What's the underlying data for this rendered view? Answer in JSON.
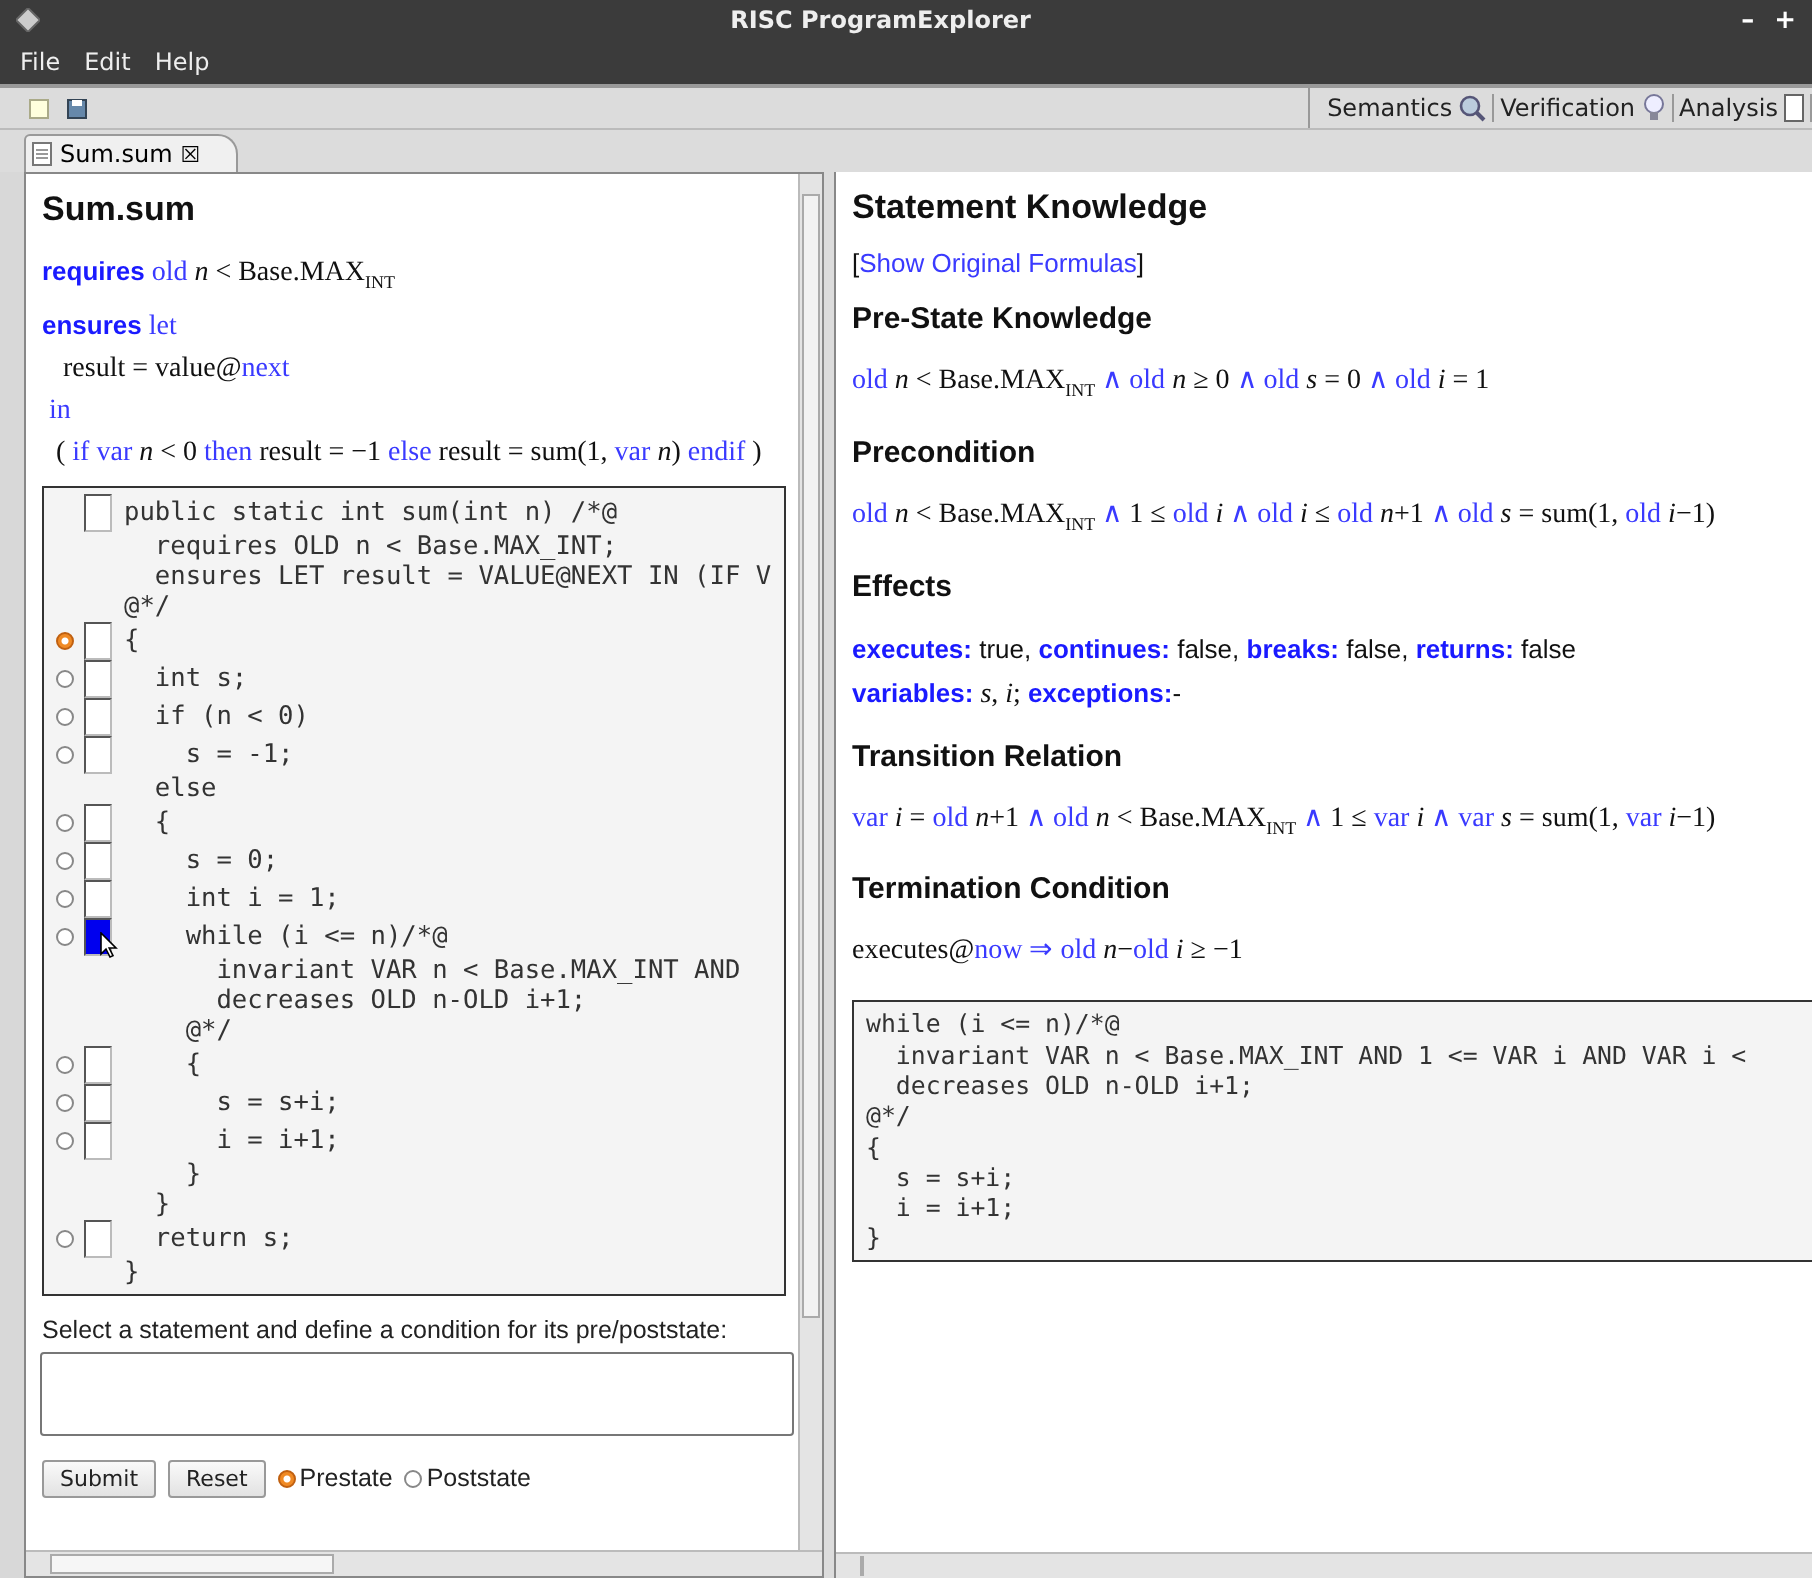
{
  "window": {
    "title": "RISC ProgramExplorer",
    "controls": [
      "–",
      "+"
    ]
  },
  "menu": [
    "File",
    "Edit",
    "Help"
  ],
  "perspectives": [
    {
      "label": "Semantics"
    },
    {
      "label": "Verification"
    },
    {
      "label": "Analysis"
    }
  ],
  "editor_tab": {
    "label": "Sum.sum",
    "close": "☒"
  },
  "method": {
    "title": "Sum.sum",
    "spec": [
      [
        {
          "kind": "label",
          "text": "requires"
        },
        {
          "kind": "kw",
          "text": " old"
        },
        {
          "kind": "math",
          "text": " *n* < Base.MAX$_{INT}$"
        }
      ],
      [
        {
          "kind": "label",
          "text": "ensures"
        },
        {
          "kind": "kw",
          "text": " let"
        }
      ],
      [
        {
          "kind": "math",
          "text": "   result = value@"
        },
        {
          "kind": "kw",
          "text": "next"
        }
      ],
      [
        {
          "kind": "kw",
          "text": " in"
        }
      ],
      [
        {
          "kind": "math",
          "text": "  ( "
        },
        {
          "kind": "kw",
          "text": "if var"
        },
        {
          "kind": "math",
          "text": " *n* < 0 "
        },
        {
          "kind": "kw",
          "text": "then"
        },
        {
          "kind": "math",
          "text": " result = −1 "
        },
        {
          "kind": "kw",
          "text": "else"
        },
        {
          "kind": "math",
          "text": " result = sum(1, "
        },
        {
          "kind": "kw",
          "text": "var"
        },
        {
          "kind": "math",
          "text": " *n*) "
        },
        {
          "kind": "kw",
          "text": "endif"
        },
        {
          "kind": "math",
          "text": " )"
        }
      ]
    ],
    "code": [
      {
        "kind": "header",
        "text": "public static int sum(int n) /*@",
        "highlighted": false
      },
      {
        "kind": "plain",
        "text": "  requires OLD n < Base.MAX_INT;"
      },
      {
        "kind": "plain",
        "text": "  ensures LET result = VALUE@NEXT IN (IF V"
      },
      {
        "kind": "plain",
        "text": "@*/"
      },
      {
        "kind": "statement",
        "text": "{",
        "selected": true,
        "highlighted": false
      },
      {
        "kind": "statement",
        "text": "  int s;",
        "selected": false,
        "highlighted": false
      },
      {
        "kind": "statement",
        "text": "  if (n < 0)",
        "selected": false,
        "highlighted": false
      },
      {
        "kind": "statement",
        "text": "    s = -1;",
        "selected": false,
        "highlighted": false
      },
      {
        "kind": "plain",
        "text": "  else"
      },
      {
        "kind": "statement",
        "text": "  {",
        "selected": false,
        "highlighted": false
      },
      {
        "kind": "statement",
        "text": "    s = 0;",
        "selected": false,
        "highlighted": false
      },
      {
        "kind": "statement",
        "text": "    int i = 1;",
        "selected": false,
        "highlighted": false
      },
      {
        "kind": "statement",
        "text": "    while (i <= n)/*@",
        "selected": false,
        "highlighted": true
      },
      {
        "kind": "plain",
        "text": "      invariant VAR n < Base.MAX_INT AND"
      },
      {
        "kind": "plain",
        "text": "      decreases OLD n-OLD i+1;"
      },
      {
        "kind": "plain",
        "text": "    @*/"
      },
      {
        "kind": "statement",
        "text": "    {",
        "selected": false,
        "highlighted": false
      },
      {
        "kind": "statement",
        "text": "      s = s+i;",
        "selected": false,
        "highlighted": false
      },
      {
        "kind": "statement",
        "text": "      i = i+1;",
        "selected": false,
        "highlighted": false
      },
      {
        "kind": "plain",
        "text": "    }"
      },
      {
        "kind": "plain",
        "text": "  }"
      },
      {
        "kind": "statement",
        "text": "  return s;",
        "selected": false,
        "highlighted": false
      },
      {
        "kind": "plain",
        "text": "}"
      }
    ]
  },
  "condition": {
    "label": "Select a statement and define a condition for its pre/poststate:",
    "buttons": [
      "Submit",
      "Reset"
    ],
    "states": [
      {
        "label": "Prestate",
        "selected": true
      },
      {
        "label": "Poststate",
        "selected": false
      }
    ]
  },
  "knowledge": {
    "title": "Statement Knowledge",
    "link": {
      "open": "[",
      "text": "Show Original Formulas",
      "close": "]"
    },
    "sections": [
      {
        "heading": "Pre-State Knowledge",
        "lines": [
          [
            {
              "kind": "kw",
              "text": "old"
            },
            {
              "kind": "math",
              "text": " *n* < Base.MAX$_{INT}$ "
            },
            {
              "kind": "kw",
              "text": "∧ old"
            },
            {
              "kind": "math",
              "text": " *n* ≥ 0 "
            },
            {
              "kind": "kw",
              "text": "∧ old"
            },
            {
              "kind": "math",
              "text": " *s* = 0 "
            },
            {
              "kind": "kw",
              "text": "∧ old"
            },
            {
              "kind": "math",
              "text": " *i* = 1"
            }
          ]
        ]
      },
      {
        "heading": "Precondition",
        "lines": [
          [
            {
              "kind": "kw",
              "text": "old"
            },
            {
              "kind": "math",
              "text": " *n* < Base.MAX$_{INT}$ "
            },
            {
              "kind": "kw",
              "text": "∧"
            },
            {
              "kind": "math",
              "text": " 1 ≤ "
            },
            {
              "kind": "kw",
              "text": "old"
            },
            {
              "kind": "math",
              "text": " *i* "
            },
            {
              "kind": "kw",
              "text": "∧ old"
            },
            {
              "kind": "math",
              "text": " *i* ≤ "
            },
            {
              "kind": "kw",
              "text": "old"
            },
            {
              "kind": "math",
              "text": " *n*+1 "
            },
            {
              "kind": "kw",
              "text": "∧ old"
            },
            {
              "kind": "math",
              "text": " *s* = sum(1, "
            },
            {
              "kind": "kw",
              "text": "old"
            },
            {
              "kind": "math",
              "text": " *i*−1)"
            }
          ]
        ]
      },
      {
        "heading": "Effects",
        "lines": [
          [
            {
              "kind": "label",
              "text": "executes:"
            },
            {
              "kind": "text",
              "text": " true, "
            },
            {
              "kind": "label",
              "text": "continues:"
            },
            {
              "kind": "text",
              "text": " false, "
            },
            {
              "kind": "label",
              "text": "breaks:"
            },
            {
              "kind": "text",
              "text": " false, "
            },
            {
              "kind": "label",
              "text": "returns:"
            },
            {
              "kind": "text",
              "text": " false"
            }
          ],
          [
            {
              "kind": "label",
              "text": "variables:"
            },
            {
              "kind": "math",
              "text": " *s*, *i*; "
            },
            {
              "kind": "label",
              "text": "exceptions:"
            },
            {
              "kind": "text",
              "text": "-"
            }
          ]
        ]
      },
      {
        "heading": "Transition Relation",
        "lines": [
          [
            {
              "kind": "kw",
              "text": "var"
            },
            {
              "kind": "math",
              "text": " *i* = "
            },
            {
              "kind": "kw",
              "text": "old"
            },
            {
              "kind": "math",
              "text": " *n*+1 "
            },
            {
              "kind": "kw",
              "text": "∧ old"
            },
            {
              "kind": "math",
              "text": " *n* < Base.MAX$_{INT}$ "
            },
            {
              "kind": "kw",
              "text": "∧"
            },
            {
              "kind": "math",
              "text": " 1 ≤ "
            },
            {
              "kind": "kw",
              "text": "var"
            },
            {
              "kind": "math",
              "text": " *i* "
            },
            {
              "kind": "kw",
              "text": "∧ var"
            },
            {
              "kind": "math",
              "text": " *s* = sum(1, "
            },
            {
              "kind": "kw",
              "text": "var"
            },
            {
              "kind": "math",
              "text": " *i*−1)"
            }
          ]
        ]
      },
      {
        "heading": "Termination Condition",
        "lines": [
          [
            {
              "kind": "math",
              "text": "executes@"
            },
            {
              "kind": "kw",
              "text": "now ⇒ old"
            },
            {
              "kind": "math",
              "text": " *n*−"
            },
            {
              "kind": "kw",
              "text": "old"
            },
            {
              "kind": "math",
              "text": " *i* ≥ −1"
            }
          ]
        ]
      }
    ],
    "code": [
      "while (i <= n)/*@",
      "  invariant VAR n < Base.MAX_INT AND 1 <= VAR i AND VAR i <",
      "  decreases OLD n-OLD i+1;",
      "@*/",
      "{",
      "  s = s+i;",
      "  i = i+1;",
      "}"
    ]
  }
}
